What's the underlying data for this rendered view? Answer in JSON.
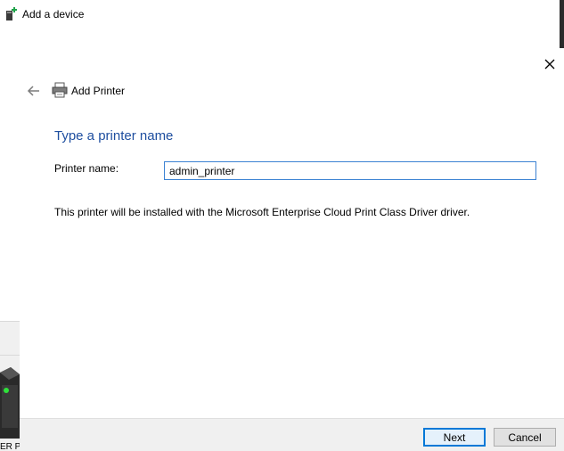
{
  "background_window": {
    "title": "Add a device",
    "device_caption": "ER P..."
  },
  "dialog": {
    "header_title": "Add Printer",
    "heading": "Type a printer name",
    "field_label": "Printer name:",
    "printer_name_value": "admin_printer",
    "info_text": "This printer will be installed with the Microsoft Enterprise Cloud Print Class Driver driver.",
    "buttons": {
      "next": "Next",
      "cancel": "Cancel"
    }
  },
  "icons": {
    "title_icon": "add-device-icon",
    "close": "close-icon",
    "back": "back-arrow-icon",
    "printer": "printer-icon"
  },
  "colors": {
    "heading": "#1e4e9f",
    "input_focus_border": "#3c82d3",
    "default_button_border": "#0078d7",
    "footer_bg": "#f0f0f0"
  }
}
